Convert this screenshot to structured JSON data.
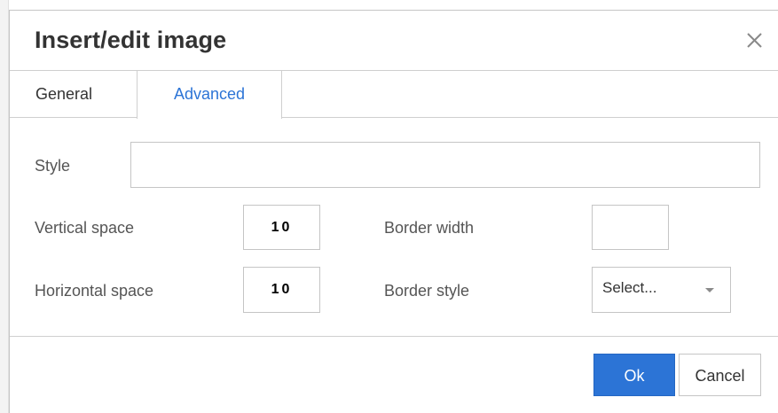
{
  "dialog": {
    "title": "Insert/edit image",
    "close_icon": "close-icon"
  },
  "tabs": [
    {
      "label": "General",
      "active": false
    },
    {
      "label": "Advanced",
      "active": true
    }
  ],
  "form": {
    "style": {
      "label": "Style",
      "value": ""
    },
    "vertical_space": {
      "label": "Vertical space",
      "value": "10"
    },
    "horizontal_space": {
      "label": "Horizontal space",
      "value": "10"
    },
    "border_width": {
      "label": "Border width",
      "value": ""
    },
    "border_style": {
      "label": "Border style",
      "selected": "Select...",
      "caret_icon": "caret-down-icon"
    }
  },
  "buttons": {
    "ok": "Ok",
    "cancel": "Cancel"
  },
  "colors": {
    "accent": "#2c74d6",
    "text": "#333333",
    "label": "#555555",
    "border": "#c5c5c5"
  }
}
